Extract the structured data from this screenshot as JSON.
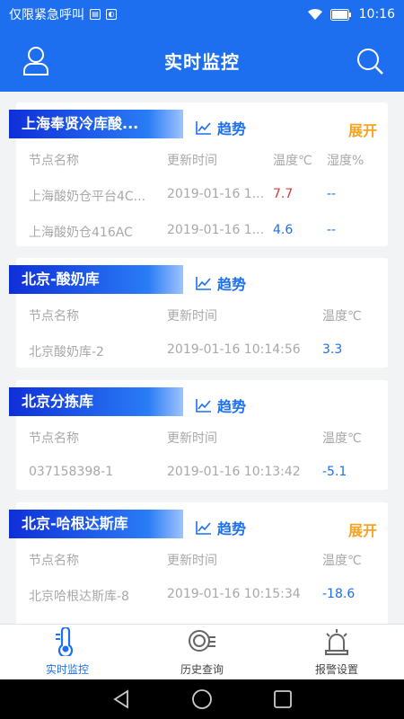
{
  "status_bar": {
    "carrier": "仅限紧急呼叫",
    "time": "10:16"
  },
  "header": {
    "title": "实时监控"
  },
  "cards": [
    {
      "name": "上海奉贤冷库酸...",
      "trend_label": "趋势",
      "expand_label": "展开",
      "columns": [
        "节点名称",
        "更新时间",
        "温度℃",
        "湿度%"
      ],
      "rows": [
        {
          "node": "上海酸奶仓平台4C...",
          "time": "2019-01-16 1...",
          "temp": "7.7",
          "hum": "--"
        },
        {
          "node": "上海酸奶仓416AC",
          "time": "2019-01-16 1...",
          "temp": "4.6",
          "hum": "--"
        }
      ]
    },
    {
      "name": "北京-酸奶库",
      "trend_label": "趋势",
      "columns": [
        "节点名称",
        "更新时间",
        "温度℃"
      ],
      "rows": [
        {
          "node": "北京酸奶库-2",
          "time": "2019-01-16 10:14:56",
          "temp": "3.3"
        }
      ]
    },
    {
      "name": "北京分拣库",
      "trend_label": "趋势",
      "columns": [
        "节点名称",
        "更新时间",
        "温度℃"
      ],
      "rows": [
        {
          "node": "037158398-1",
          "time": "2019-01-16 10:13:42",
          "temp": "-5.1"
        }
      ]
    },
    {
      "name": "北京-哈根达斯库",
      "trend_label": "趋势",
      "expand_label": "展开",
      "columns": [
        "节点名称",
        "更新时间",
        "温度℃"
      ],
      "rows": [
        {
          "node": "北京哈根达斯库-8",
          "time": "2019-01-16 10:15:34",
          "temp": "-18.6"
        }
      ]
    }
  ],
  "tabs": [
    {
      "label": "实时监控",
      "icon": "thermometer-icon",
      "active": true
    },
    {
      "label": "历史查询",
      "icon": "history-search-icon",
      "active": false
    },
    {
      "label": "报警设置",
      "icon": "alarm-siren-icon",
      "active": false
    }
  ],
  "colors": {
    "primary": "#1d6ff0",
    "expand": "#f5a425",
    "alert_temp": "#d33a32",
    "muted_text": "#a8a8a8"
  }
}
